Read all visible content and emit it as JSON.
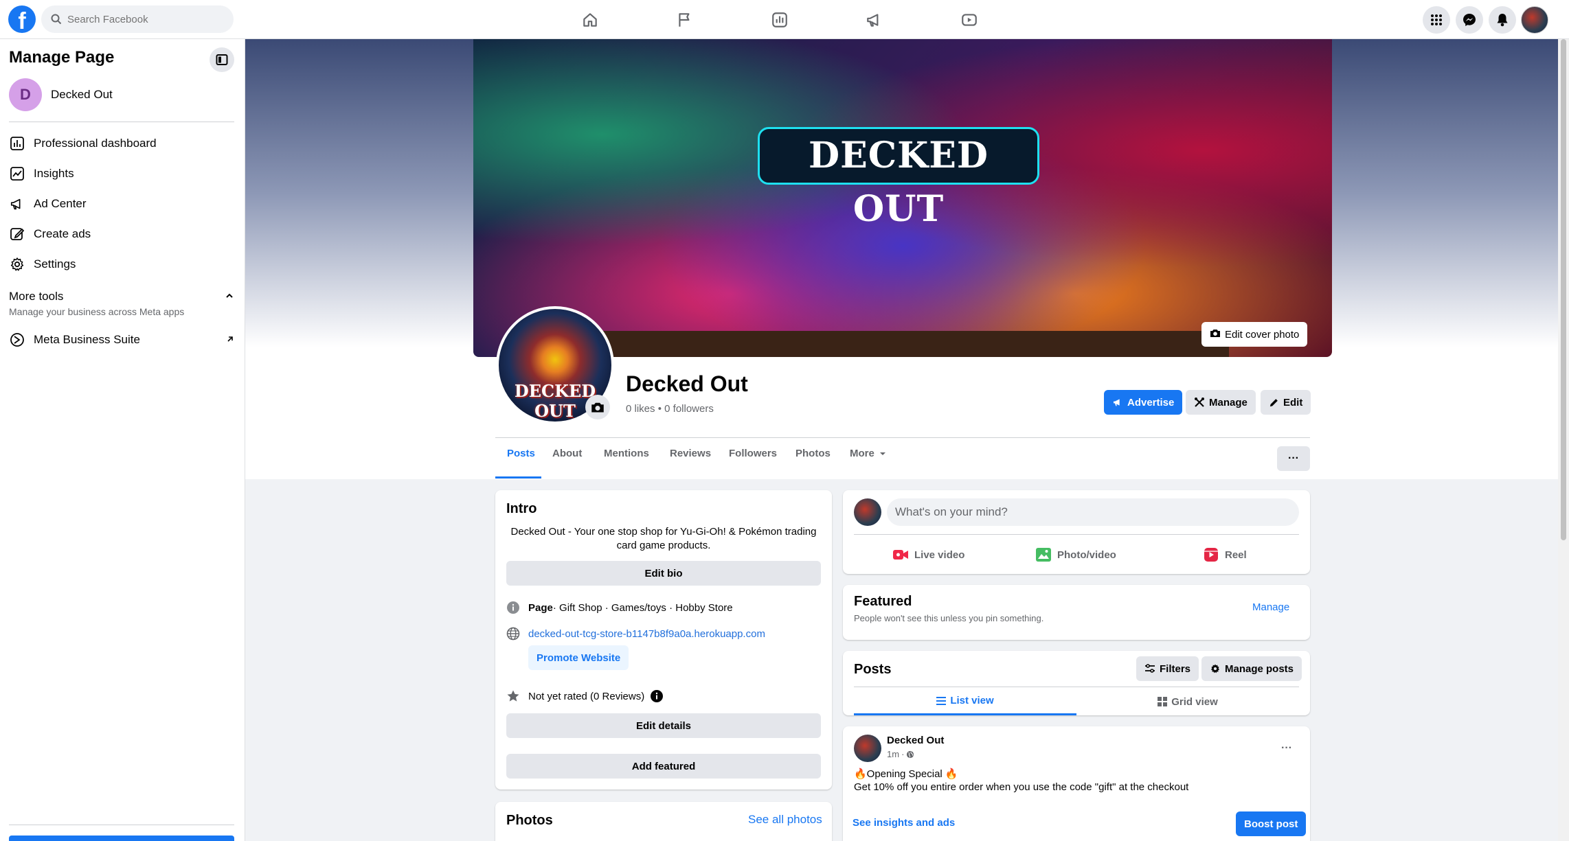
{
  "topbar": {
    "search_placeholder": "Search Facebook",
    "nav_icons": [
      "home-icon",
      "flag-icon",
      "chart-icon",
      "megaphone-icon",
      "video-icon"
    ],
    "right_icons": [
      "menu-grid-icon",
      "messenger-icon",
      "bell-icon"
    ]
  },
  "sidebar": {
    "title": "Manage Page",
    "page_name": "Decked Out",
    "page_initial": "D",
    "items": [
      {
        "label": "Professional dashboard",
        "icon": "dashboard-icon"
      },
      {
        "label": "Insights",
        "icon": "insights-icon"
      },
      {
        "label": "Ad Center",
        "icon": "megaphone-icon"
      },
      {
        "label": "Create ads",
        "icon": "pencil-icon"
      },
      {
        "label": "Settings",
        "icon": "gear-icon"
      }
    ],
    "more_tools": {
      "title": "More tools",
      "subtitle": "Manage your business across Meta apps"
    },
    "meta_business_suite": "Meta Business Suite"
  },
  "cover": {
    "title": "DECKED OUT",
    "edit_label": "Edit cover photo"
  },
  "profile": {
    "logo_text": "DECKED OUT",
    "name": "Decked Out",
    "likes": "0 likes",
    "separator": "•",
    "followers": "0 followers",
    "buttons": {
      "advertise": "Advertise",
      "manage": "Manage",
      "edit": "Edit"
    }
  },
  "tabs": [
    "Posts",
    "About",
    "Mentions",
    "Reviews",
    "Followers",
    "Photos",
    "More"
  ],
  "more_dots": "···",
  "intro": {
    "title": "Intro",
    "bio_line1": "Decked Out - Your one stop shop for Yu-Gi-Oh! & Pokémon trading",
    "bio_line2": "card game products.",
    "edit_bio": "Edit bio",
    "category_prefix": "Page",
    "categories": " · Gift Shop · Games/toys · Hobby Store",
    "website": "decked-out-tcg-store-b1147b8f9a0a.herokuapp.com",
    "promote_website": "Promote Website",
    "rating": "Not yet rated (0 Reviews)",
    "edit_details": "Edit details",
    "add_featured": "Add featured"
  },
  "photos": {
    "title": "Photos",
    "see_all": "See all photos"
  },
  "composer": {
    "placeholder": "What's on your mind?",
    "actions": [
      "Live video",
      "Photo/video",
      "Reel"
    ]
  },
  "featured": {
    "title": "Featured",
    "subtitle": "People won't see this unless you pin something.",
    "manage": "Manage"
  },
  "posts_section": {
    "title": "Posts",
    "filters": "Filters",
    "manage_posts": "Manage posts",
    "list_view": "List view",
    "grid_view": "Grid view"
  },
  "post": {
    "author": "Decked Out",
    "time": "1m",
    "time_sep": "·",
    "line1": "🔥Opening Special 🔥",
    "line2": "Get 10% off you entire order when you use the code \"gift\" at the checkout",
    "insights_link": "See insights and ads",
    "boost": "Boost post",
    "dots": "···"
  },
  "colors": {
    "brand": "#1877f2",
    "background": "#f0f2f5",
    "button_grey": "#e4e6eb",
    "text_secondary": "#65676b"
  }
}
